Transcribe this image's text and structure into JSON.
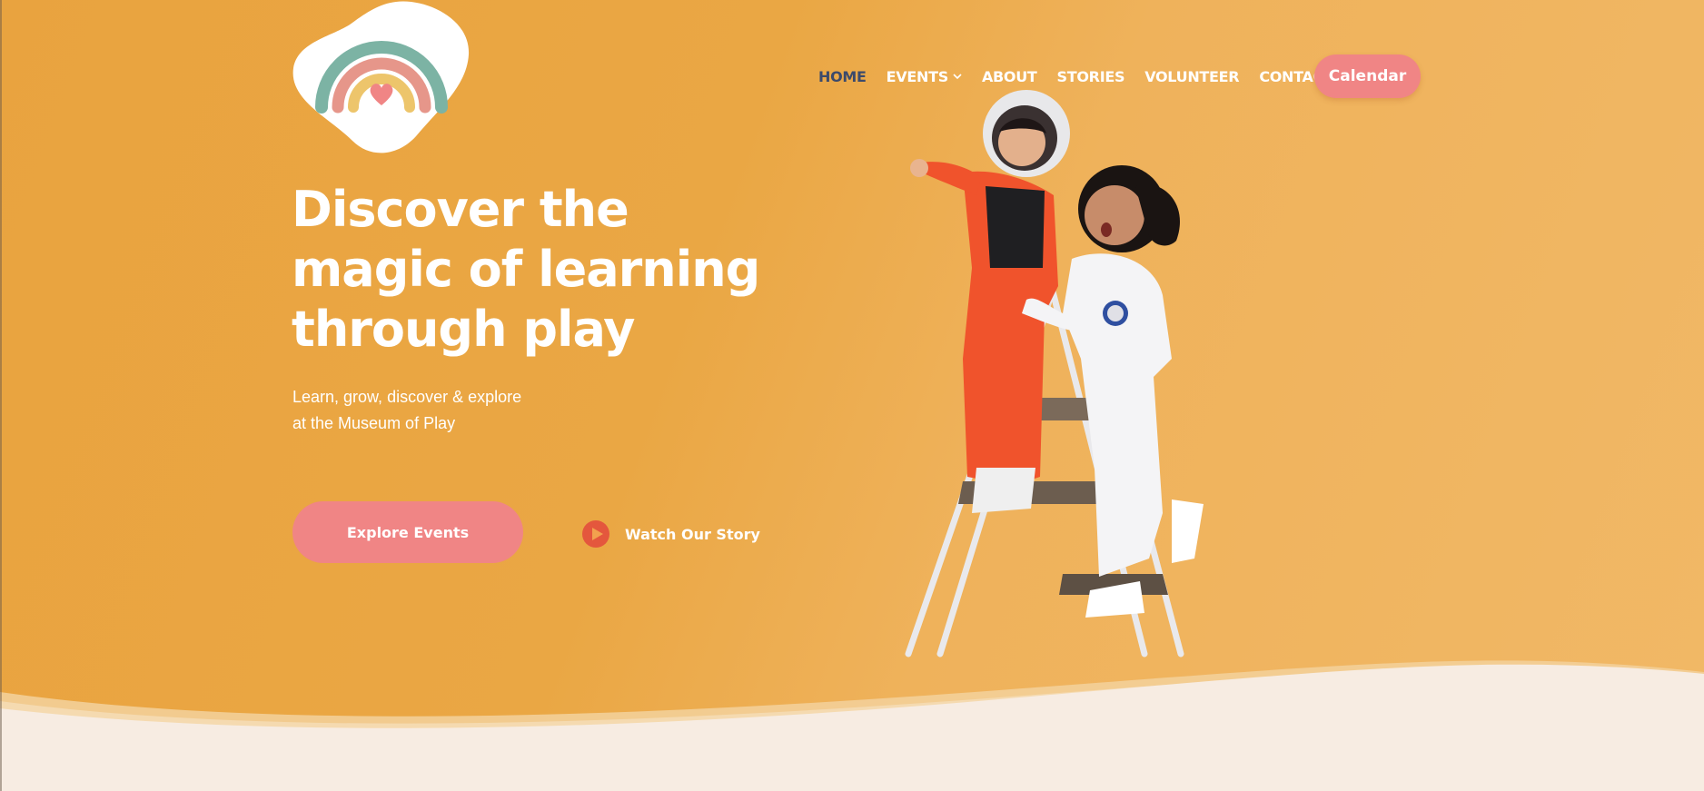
{
  "nav": {
    "items": [
      {
        "label": "HOME",
        "active": true
      },
      {
        "label": "EVENTS",
        "dropdown": true
      },
      {
        "label": "ABOUT"
      },
      {
        "label": "STORIES"
      },
      {
        "label": "VOLUNTEER"
      },
      {
        "label": "CONTACT"
      }
    ],
    "calendar_label": "Calendar"
  },
  "hero": {
    "headline_lines": [
      "Discover the",
      "magic of learning",
      "through play"
    ],
    "subtitle_lines": [
      "Learn, grow, discover & explore",
      "at the Museum of Play"
    ],
    "primary_cta": "Explore Events",
    "secondary_cta": "Watch Our Story"
  },
  "icons": {
    "logo": "rainbow-heart-logo",
    "dropdown": "chevron-down-icon",
    "play": "play-circle-icon"
  },
  "colors": {
    "hero_bg": "#eaa744",
    "accent_pink": "#f08585",
    "nav_active": "#3c4a6b",
    "footer_cream": "#f7ece2",
    "play_red": "#e4573d"
  }
}
